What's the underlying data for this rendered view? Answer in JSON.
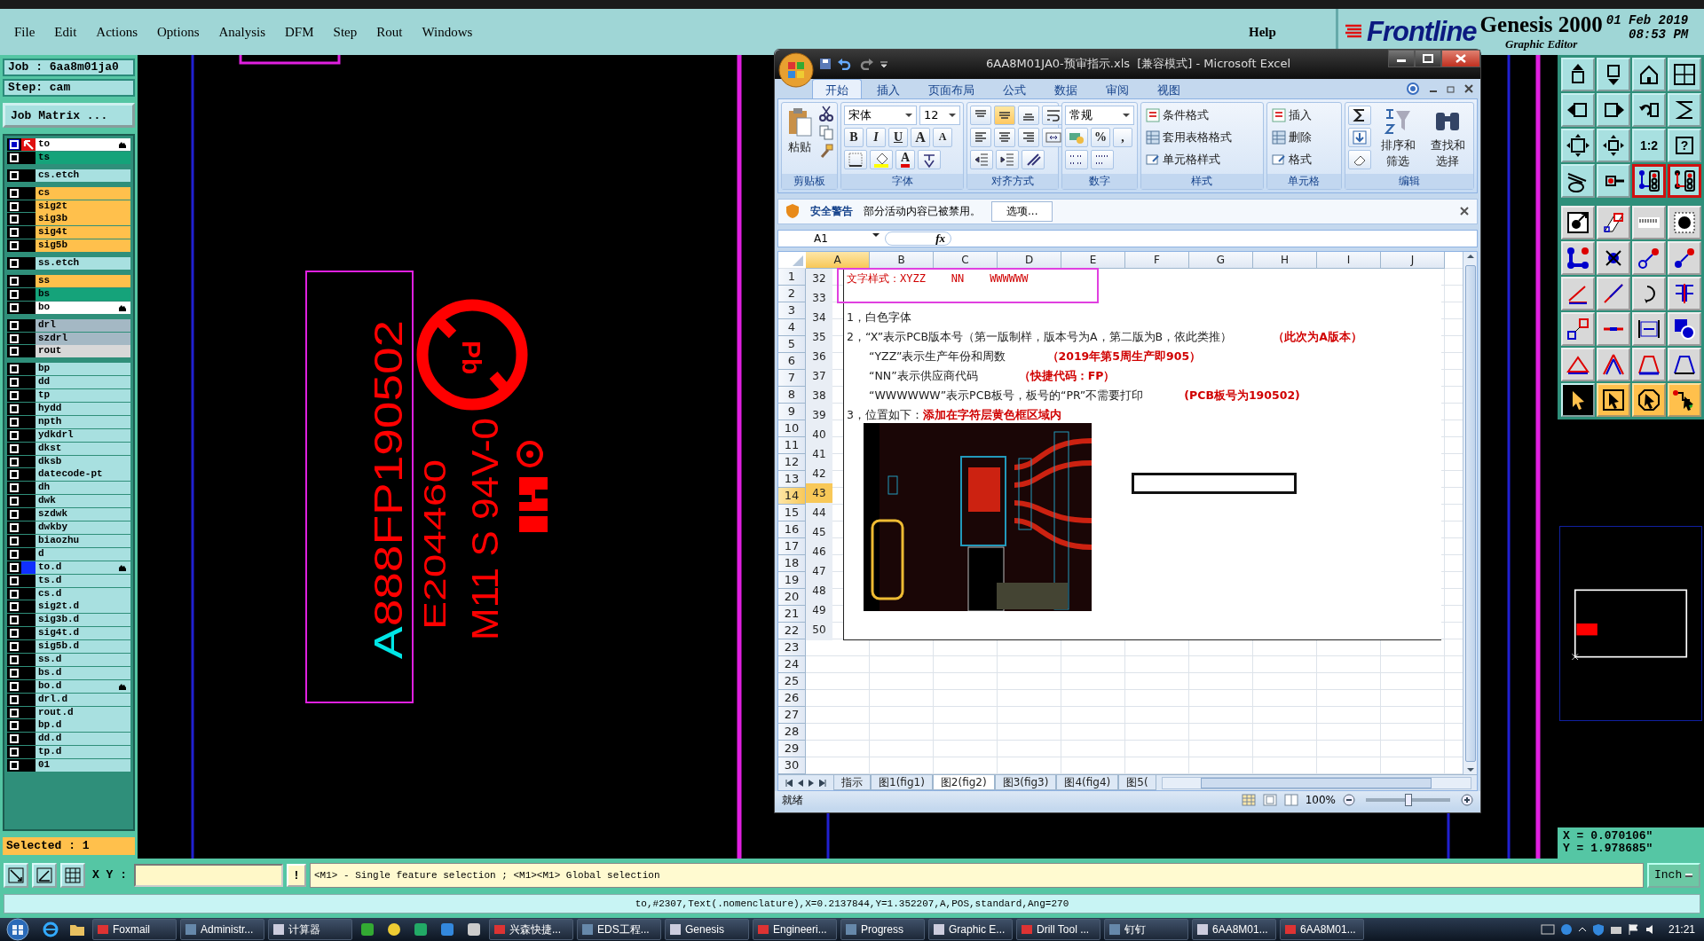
{
  "menu_bar": {
    "items": [
      "File",
      "Edit",
      "Actions",
      "Options",
      "Analysis",
      "DFM",
      "Step",
      "Rout",
      "Windows"
    ],
    "help": "Help",
    "brand": "Frontline",
    "product": "Genesis 2000",
    "subtitle": "Graphic Editor",
    "date": "01 Feb 2019",
    "time": "08:53 PM"
  },
  "job_panel": {
    "job": "Job : 6aa8m01ja0",
    "step": "Step: cam",
    "matrix_button": "Job Matrix ...",
    "selected": "Selected : 1",
    "layer_groups": [
      [
        {
          "name": "to",
          "color": "#ffffff",
          "checked": true,
          "work": true,
          "displayed": false,
          "editing": true
        },
        {
          "name": "ts",
          "color": "#15a37a",
          "checked": false,
          "work": false,
          "displayed": false,
          "editing": false
        }
      ],
      [
        {
          "name": "cs.etch",
          "color": "#a8e0e0",
          "checked": false,
          "work": false,
          "displayed": false,
          "editing": false
        }
      ],
      [
        {
          "name": "cs",
          "color": "#ffc04c",
          "checked": false,
          "work": false,
          "displayed": false,
          "editing": false
        },
        {
          "name": "sig2t",
          "color": "#ffc04c",
          "checked": false,
          "work": false,
          "displayed": false,
          "editing": false
        },
        {
          "name": "sig3b",
          "color": "#ffc04c",
          "checked": false,
          "work": false,
          "displayed": false,
          "editing": false
        },
        {
          "name": "sig4t",
          "color": "#ffc04c",
          "checked": false,
          "work": false,
          "displayed": false,
          "editing": false
        },
        {
          "name": "sig5b",
          "color": "#ffc04c",
          "checked": false,
          "work": false,
          "displayed": false,
          "editing": false
        }
      ],
      [
        {
          "name": "ss.etch",
          "color": "#a8e0e0",
          "checked": false,
          "work": false,
          "displayed": false,
          "editing": false
        }
      ],
      [
        {
          "name": "ss",
          "color": "#ffc04c",
          "checked": false,
          "work": false,
          "displayed": false,
          "editing": false
        },
        {
          "name": "bs",
          "color": "#15a37a",
          "checked": false,
          "work": false,
          "displayed": false,
          "editing": false
        },
        {
          "name": "bo",
          "color": "#ffffff",
          "checked": false,
          "work": false,
          "displayed": false,
          "editing": true
        }
      ],
      [
        {
          "name": "drl",
          "color": "#a4b8c4",
          "checked": false,
          "work": false,
          "displayed": false,
          "editing": false
        },
        {
          "name": "szdrl",
          "color": "#a4b8c4",
          "checked": false,
          "work": false,
          "displayed": false,
          "editing": false
        },
        {
          "name": "rout",
          "color": "#d8d8d8",
          "checked": false,
          "work": false,
          "displayed": false,
          "editing": false
        }
      ],
      [
        {
          "name": "bp",
          "color": "#a8e0e0",
          "checked": false,
          "work": false,
          "displayed": false,
          "editing": false
        },
        {
          "name": "dd",
          "color": "#a8e0e0",
          "checked": false,
          "work": false,
          "displayed": false,
          "editing": false
        },
        {
          "name": "tp",
          "color": "#a8e0e0",
          "checked": false,
          "work": false,
          "displayed": false,
          "editing": false
        },
        {
          "name": "hydd",
          "color": "#a8e0e0",
          "checked": false,
          "work": false,
          "displayed": false,
          "editing": false
        },
        {
          "name": "npth",
          "color": "#a8e0e0",
          "checked": false,
          "work": false,
          "displayed": false,
          "editing": false
        },
        {
          "name": "ydkdrl",
          "color": "#a8e0e0",
          "checked": false,
          "work": false,
          "displayed": false,
          "editing": false
        },
        {
          "name": "dkst",
          "color": "#a8e0e0",
          "checked": false,
          "work": false,
          "displayed": false,
          "editing": false
        },
        {
          "name": "dksb",
          "color": "#a8e0e0",
          "checked": false,
          "work": false,
          "displayed": false,
          "editing": false
        },
        {
          "name": "datecode-pt",
          "color": "#a8e0e0",
          "checked": false,
          "work": false,
          "displayed": false,
          "editing": false
        },
        {
          "name": "dh",
          "color": "#a8e0e0",
          "checked": false,
          "work": false,
          "displayed": false,
          "editing": false
        },
        {
          "name": "dwk",
          "color": "#a8e0e0",
          "checked": false,
          "work": false,
          "displayed": false,
          "editing": false
        },
        {
          "name": "szdwk",
          "color": "#a8e0e0",
          "checked": false,
          "work": false,
          "displayed": false,
          "editing": false
        },
        {
          "name": "dwkby",
          "color": "#a8e0e0",
          "checked": false,
          "work": false,
          "displayed": false,
          "editing": false
        },
        {
          "name": "biaozhu",
          "color": "#a8e0e0",
          "checked": false,
          "work": false,
          "displayed": false,
          "editing": false
        },
        {
          "name": "d",
          "color": "#a8e0e0",
          "checked": false,
          "work": false,
          "displayed": false,
          "editing": false
        },
        {
          "name": "to.d",
          "color": "#a8e0e0",
          "checked": false,
          "work": false,
          "displayed": true,
          "editing": true
        },
        {
          "name": "ts.d",
          "color": "#a8e0e0",
          "checked": false,
          "work": false,
          "displayed": false,
          "editing": false
        },
        {
          "name": "cs.d",
          "color": "#a8e0e0",
          "checked": false,
          "work": false,
          "displayed": false,
          "editing": false
        },
        {
          "name": "sig2t.d",
          "color": "#a8e0e0",
          "checked": false,
          "work": false,
          "displayed": false,
          "editing": false
        },
        {
          "name": "sig3b.d",
          "color": "#a8e0e0",
          "checked": false,
          "work": false,
          "displayed": false,
          "editing": false
        },
        {
          "name": "sig4t.d",
          "color": "#a8e0e0",
          "checked": false,
          "work": false,
          "displayed": false,
          "editing": false
        },
        {
          "name": "sig5b.d",
          "color": "#a8e0e0",
          "checked": false,
          "work": false,
          "displayed": false,
          "editing": false
        },
        {
          "name": "ss.d",
          "color": "#a8e0e0",
          "checked": false,
          "work": false,
          "displayed": false,
          "editing": false
        },
        {
          "name": "bs.d",
          "color": "#a8e0e0",
          "checked": false,
          "work": false,
          "displayed": false,
          "editing": false
        },
        {
          "name": "bo.d",
          "color": "#a8e0e0",
          "checked": false,
          "work": false,
          "displayed": false,
          "editing": true
        },
        {
          "name": "drl.d",
          "color": "#a8e0e0",
          "checked": false,
          "work": false,
          "displayed": false,
          "editing": false
        },
        {
          "name": "rout.d",
          "color": "#a8e0e0",
          "checked": false,
          "work": false,
          "displayed": false,
          "editing": false
        },
        {
          "name": "bp.d",
          "color": "#a8e0e0",
          "checked": false,
          "work": false,
          "displayed": false,
          "editing": false
        },
        {
          "name": "dd.d",
          "color": "#a8e0e0",
          "checked": false,
          "work": false,
          "displayed": false,
          "editing": false
        },
        {
          "name": "tp.d",
          "color": "#a8e0e0",
          "checked": false,
          "work": false,
          "displayed": false,
          "editing": false
        },
        {
          "name": "01",
          "color": "#a8e0e0",
          "checked": false,
          "work": false,
          "displayed": false,
          "editing": false
        }
      ]
    ]
  },
  "canvas": {
    "serial": [
      {
        "text": "A",
        "color": "#00e6e6"
      },
      {
        "text": "888FP190502",
        "color": "#ff0000"
      }
    ],
    "ul_number": "E204460",
    "rating": "M11 S 94V-0",
    "lead_symbol": "Pb"
  },
  "toolbox": {
    "labels": [
      "1:2",
      "?"
    ]
  },
  "coordinates": {
    "x": "X = 0.070106\"",
    "y": "Y = 1.978685\""
  },
  "excel": {
    "title": "6AA8M01JA0-预审指示.xls  [兼容模式] - Microsoft Excel",
    "tabs": [
      {
        "label": "开始",
        "selected": true
      },
      {
        "label": "插入",
        "selected": false
      },
      {
        "label": "页面布局",
        "selected": false
      },
      {
        "label": "公式",
        "selected": false
      },
      {
        "label": "数据",
        "selected": false
      },
      {
        "label": "审阅",
        "selected": false
      },
      {
        "label": "视图",
        "selected": false
      }
    ],
    "ribbon": {
      "paste": "粘贴",
      "font": "宋体",
      "size": "12",
      "format_buttons": [
        "B",
        "I",
        "U"
      ],
      "grow": "A",
      "shrink": "A",
      "font_color": "A",
      "vertical_align": [
        {
          "selected": false
        },
        {
          "selected": true
        },
        {
          "selected": false
        }
      ],
      "number_format": "常规",
      "percent": "%",
      "comma": ",",
      "styles": [
        "条件格式",
        "套用表格格式",
        "单元格样式"
      ],
      "cells": [
        "插入",
        "删除",
        "格式"
      ],
      "editing": [
        "排序和筛选",
        "查找和选择"
      ],
      "groups": [
        "剪贴板",
        "字体",
        "对齐方式",
        "数字",
        "样式",
        "单元格",
        "编辑"
      ]
    },
    "security": {
      "title": "安全警告",
      "message": "部分活动内容已被禁用。",
      "button": "选项..."
    },
    "name_box": "A1",
    "formula_label": "fx",
    "columns": [
      {
        "label": "A",
        "selected": true
      },
      {
        "label": "B",
        "selected": false
      },
      {
        "label": "C",
        "selected": false
      },
      {
        "label": "D",
        "selected": false
      },
      {
        "label": "E",
        "selected": false
      },
      {
        "label": "F",
        "selected": false
      },
      {
        "label": "G",
        "selected": false
      },
      {
        "label": "H",
        "selected": false
      },
      {
        "label": "I",
        "selected": false
      },
      {
        "label": "J",
        "selected": false
      }
    ],
    "rows": [
      {
        "label": "1",
        "selected": false
      },
      {
        "label": "2",
        "selected": false
      },
      {
        "label": "3",
        "selected": false
      },
      {
        "label": "4",
        "selected": false
      },
      {
        "label": "5",
        "selected": false
      },
      {
        "label": "6",
        "selected": false
      },
      {
        "label": "7",
        "selected": false
      },
      {
        "label": "8",
        "selected": false
      },
      {
        "label": "9",
        "selected": false
      },
      {
        "label": "10",
        "selected": false
      },
      {
        "label": "11",
        "selected": false
      },
      {
        "label": "12",
        "selected": false
      },
      {
        "label": "13",
        "selected": false
      },
      {
        "label": "14",
        "selected": true
      },
      {
        "label": "15",
        "selected": false
      },
      {
        "label": "16",
        "selected": false
      },
      {
        "label": "17",
        "selected": false
      },
      {
        "label": "18",
        "selected": false
      },
      {
        "label": "19",
        "selected": false
      },
      {
        "label": "20",
        "selected": false
      },
      {
        "label": "21",
        "selected": false
      },
      {
        "label": "22",
        "selected": false
      },
      {
        "label": "23",
        "selected": false
      },
      {
        "label": "24",
        "selected": false
      },
      {
        "label": "25",
        "selected": false
      },
      {
        "label": "26",
        "selected": false
      },
      {
        "label": "27",
        "selected": false
      },
      {
        "label": "28",
        "selected": false
      },
      {
        "label": "29",
        "selected": false
      },
      {
        "label": "30",
        "selected": false
      }
    ],
    "inner_rows": [
      {
        "label": "32",
        "selected": false
      },
      {
        "label": "33",
        "selected": false
      },
      {
        "label": "34",
        "selected": false
      },
      {
        "label": "35",
        "selected": false
      },
      {
        "label": "36",
        "selected": false
      },
      {
        "label": "37",
        "selected": false
      },
      {
        "label": "38",
        "selected": false
      },
      {
        "label": "39",
        "selected": false
      },
      {
        "label": "40",
        "selected": false
      },
      {
        "label": "41",
        "selected": false
      },
      {
        "label": "42",
        "selected": false
      },
      {
        "label": "43",
        "selected": true
      },
      {
        "label": "44",
        "selected": false
      },
      {
        "label": "45",
        "selected": false
      },
      {
        "label": "46",
        "selected": false
      },
      {
        "label": "47",
        "selected": false
      },
      {
        "label": "48",
        "selected": false
      },
      {
        "label": "49",
        "selected": false
      },
      {
        "label": "50",
        "selected": false
      }
    ],
    "content": [
      {
        "kind": "banner",
        "text": "文字样式：XYZZ    NN    WWWWWW"
      },
      {
        "kind": "item",
        "text": "1，白色字体"
      },
      {
        "kind": "item",
        "text": "2，“X”表示PCB版本号（第一版制样，版本号为A，第二版为B，依此类推）",
        "note": "（此次为A版本）"
      },
      {
        "kind": "sub",
        "text": "“YZZ”表示生产年份和周数",
        "note": "（2019年第5周生产即905）"
      },
      {
        "kind": "sub",
        "text": "“NN”表示供应商代码",
        "note": "（快捷代码：FP）"
      },
      {
        "kind": "sub",
        "text": "“WWWWWW”表示PCB板号，板号的“PR”不需要打印",
        "note": "(PCB板号为190502)"
      },
      {
        "kind": "lead",
        "text": "3，位置如下：",
        "note": "添加在字符层黄色框区域内"
      }
    ],
    "sheet_tabs": [
      {
        "label": "指示",
        "selected": false
      },
      {
        "label": "图1(fig1)",
        "selected": false
      },
      {
        "label": "图2(fig2)",
        "selected": true
      },
      {
        "label": "图3(fig3)",
        "selected": false
      },
      {
        "label": "图4(fig4)",
        "selected": false
      },
      {
        "label": "图5(",
        "selected": false
      }
    ],
    "status": "就绪",
    "zoom": "100%",
    "zoom_slider": {
      "level": 0.5
    }
  },
  "command_bar": {
    "xy_label": "X Y :",
    "bang": "!",
    "message": "<M1> - Single feature selection ; <M1><M1> Global selection",
    "units": "Inch"
  },
  "status_line": "to,#2307,Text(.nomenclature),X=0.2137844,Y=1.352207,A,POS,standard,Ang=270",
  "taskbar": {
    "items": [
      {
        "label": "Foxmail"
      },
      {
        "label": "Administr..."
      },
      {
        "label": "计算器"
      },
      {
        "label": "兴森快捷..."
      },
      {
        "label": "EDS工程..."
      },
      {
        "label": "Genesis"
      },
      {
        "label": "Engineeri..."
      },
      {
        "label": "Progress"
      },
      {
        "label": "Graphic E..."
      },
      {
        "label": "Drill Tool ..."
      },
      {
        "label": "钉钉"
      },
      {
        "label": "6AA8M01..."
      },
      {
        "label": "6AA8M01..."
      }
    ],
    "clock": "21:21"
  }
}
